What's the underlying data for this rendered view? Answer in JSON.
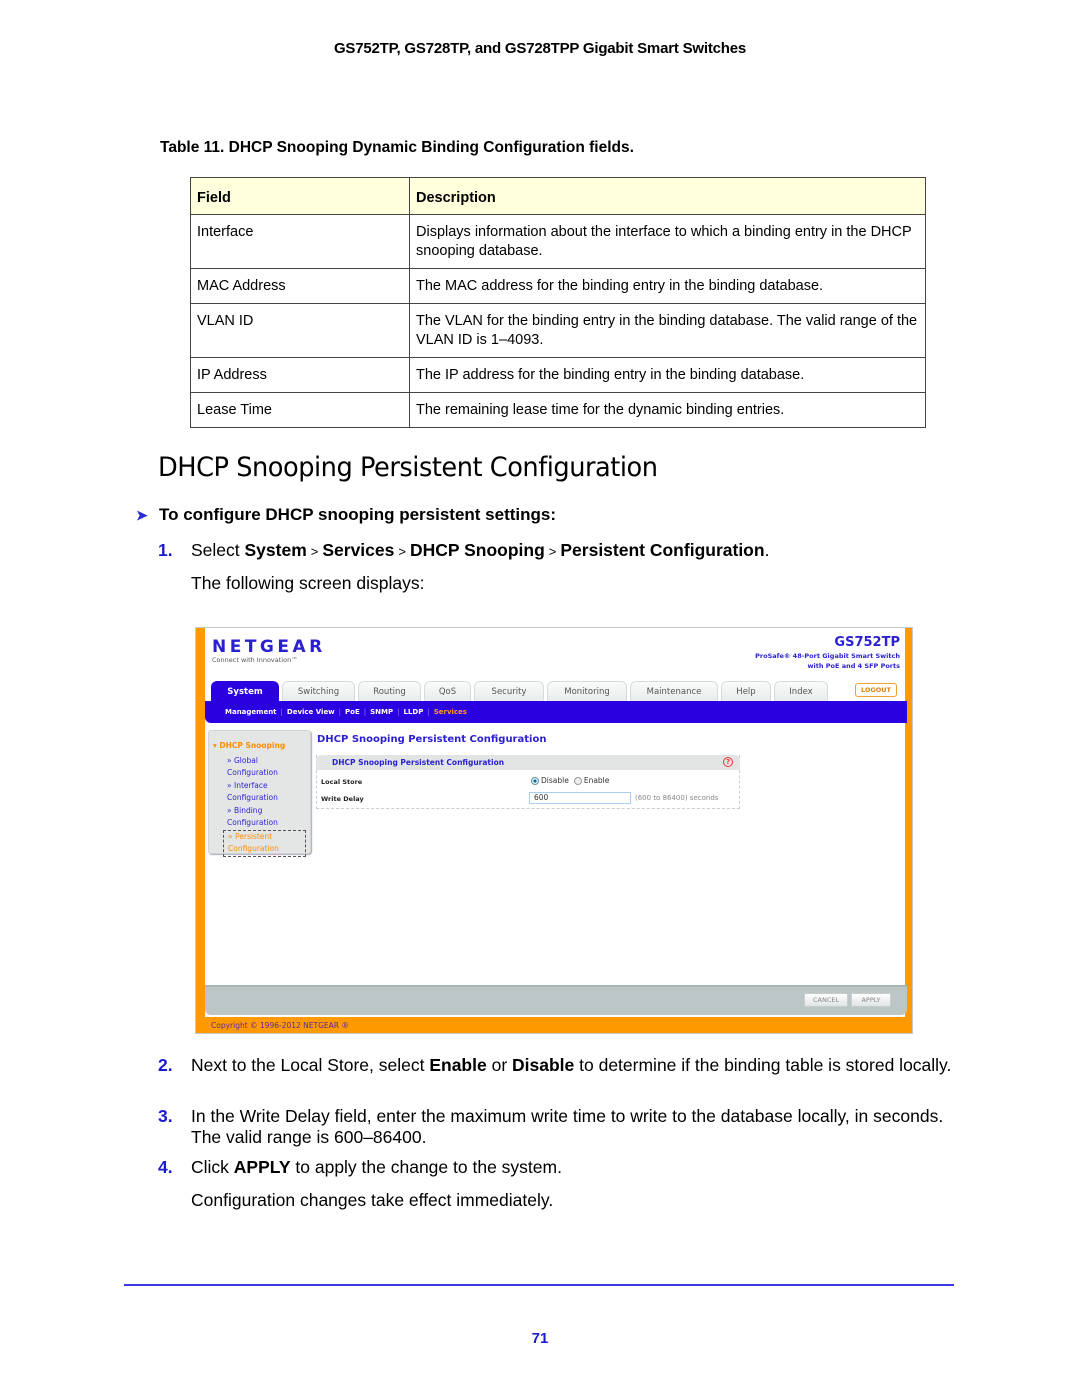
{
  "running_header": "GS752TP, GS728TP, and GS728TPP Gigabit Smart Switches",
  "table": {
    "caption": "Table 11.  DHCP Snooping Dynamic Binding Configuration fields.",
    "headers": [
      "Field",
      "Description"
    ],
    "rows": [
      {
        "field": "Interface",
        "description": "Displays information about the interface to which a binding entry in the DHCP snooping database."
      },
      {
        "field": "MAC Address",
        "description": "The MAC address for the binding entry in the binding database."
      },
      {
        "field": "VLAN ID",
        "description": "The VLAN for the binding entry in the binding database. The valid range of the VLAN ID is 1–4093."
      },
      {
        "field": "IP Address",
        "description": "The IP address for the binding entry in the binding database."
      },
      {
        "field": "Lease Time",
        "description": "The remaining lease time for the dynamic binding entries."
      }
    ],
    "header_bg": "#ffffdc"
  },
  "section_title": "DHCP Snooping Persistent Configuration",
  "procedure_heading": "To configure DHCP snooping persistent settings:",
  "steps": {
    "s1": {
      "num": "1.",
      "pre": "Select ",
      "p1": "System",
      "p2": "Services",
      "p3": "DHCP Snooping",
      "p4": "Persistent Configuration",
      "end": ".",
      "sep": ">",
      "sub": "The following screen displays:"
    },
    "s2": {
      "num": "2.",
      "a": "Next to the Local Store, select ",
      "b1": "Enable",
      "c": " or ",
      "b2": "Disable",
      "d": " to determine if the binding table is stored locally."
    },
    "s3": {
      "num": "3.",
      "text": "In the Write Delay field, enter the maximum write time to write to the database locally, in seconds. The valid range is 600–86400."
    },
    "s4": {
      "num": "4.",
      "a": "Click ",
      "b": "APPLY",
      "c": " to apply the change to the system.",
      "sub": "Configuration changes take effect immediately."
    }
  },
  "screenshot": {
    "brand": "NETGEAR",
    "tagline": "Connect with Innovation™",
    "model": "GS752TP",
    "model_desc_1": "ProSafe® 48-Port Gigabit Smart Switch",
    "model_desc_2": "with PoE and 4 SFP Ports",
    "tabs": [
      "System",
      "Switching",
      "Routing",
      "QoS",
      "Security",
      "Monitoring",
      "Maintenance",
      "Help",
      "Index"
    ],
    "active_tab": "System",
    "logout_label": "LOGOUT",
    "subnav": [
      "Management",
      "Device View",
      "PoE",
      "SNMP",
      "LLDP",
      "Services"
    ],
    "subnav_active": "Services",
    "sidebar": {
      "header": "DHCP Snooping",
      "items": [
        {
          "line1": "Global",
          "line2": "Configuration"
        },
        {
          "line1": "Interface",
          "line2": "Configuration"
        },
        {
          "line1": "Binding",
          "line2": "Configuration"
        },
        {
          "line1": "Persistent",
          "line2": "Configuration"
        }
      ],
      "active": "Persistent Configuration"
    },
    "page_title": "DHCP Snooping Persistent Configuration",
    "panel_title": "DHCP Snooping Persistent Configuration",
    "help_icon": "?",
    "fields": {
      "local_store_label": "Local Store",
      "local_store_options": [
        "Disable",
        "Enable"
      ],
      "local_store_selected": "Disable",
      "write_delay_label": "Write Delay",
      "write_delay_value": "600",
      "write_delay_range": "(600 to 86400) seconds"
    },
    "buttons": {
      "cancel": "CANCEL",
      "apply": "APPLY"
    },
    "copyright": "Copyright © 1996-2012 NETGEAR ®",
    "colors": {
      "brand_blue": "#2a00e0",
      "orange": "#ff9900"
    }
  },
  "page_number": "71"
}
